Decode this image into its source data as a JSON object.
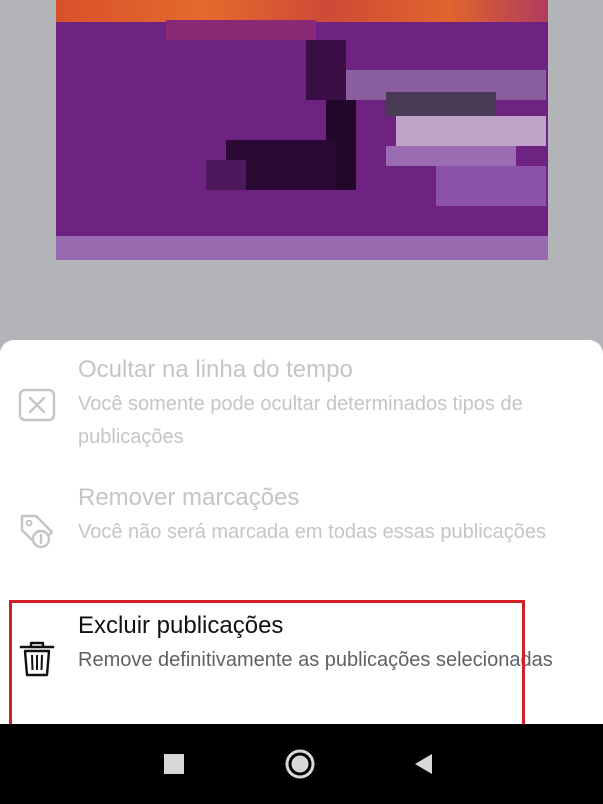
{
  "options": [
    {
      "title": "Ocultar na linha do tempo",
      "description": "Você somente pode ocultar determinados tipos de publicações",
      "icon": "close-box-icon",
      "enabled": false
    },
    {
      "title": "Remover marcações",
      "description": "Você não será marcada em todas essas publicações",
      "icon": "tag-remove-icon",
      "enabled": false
    },
    {
      "title": "Excluir publicações",
      "description": "Remove definitivamente as publicações selecionadas",
      "icon": "trash-icon",
      "enabled": true
    }
  ],
  "navbar": {
    "buttons": [
      "recents-square-icon",
      "home-circle-icon",
      "back-triangle-icon"
    ]
  },
  "colors": {
    "highlight": "#d31f26",
    "disabled_text": "#c4c5c9",
    "photo_bg": "#6e2382"
  }
}
